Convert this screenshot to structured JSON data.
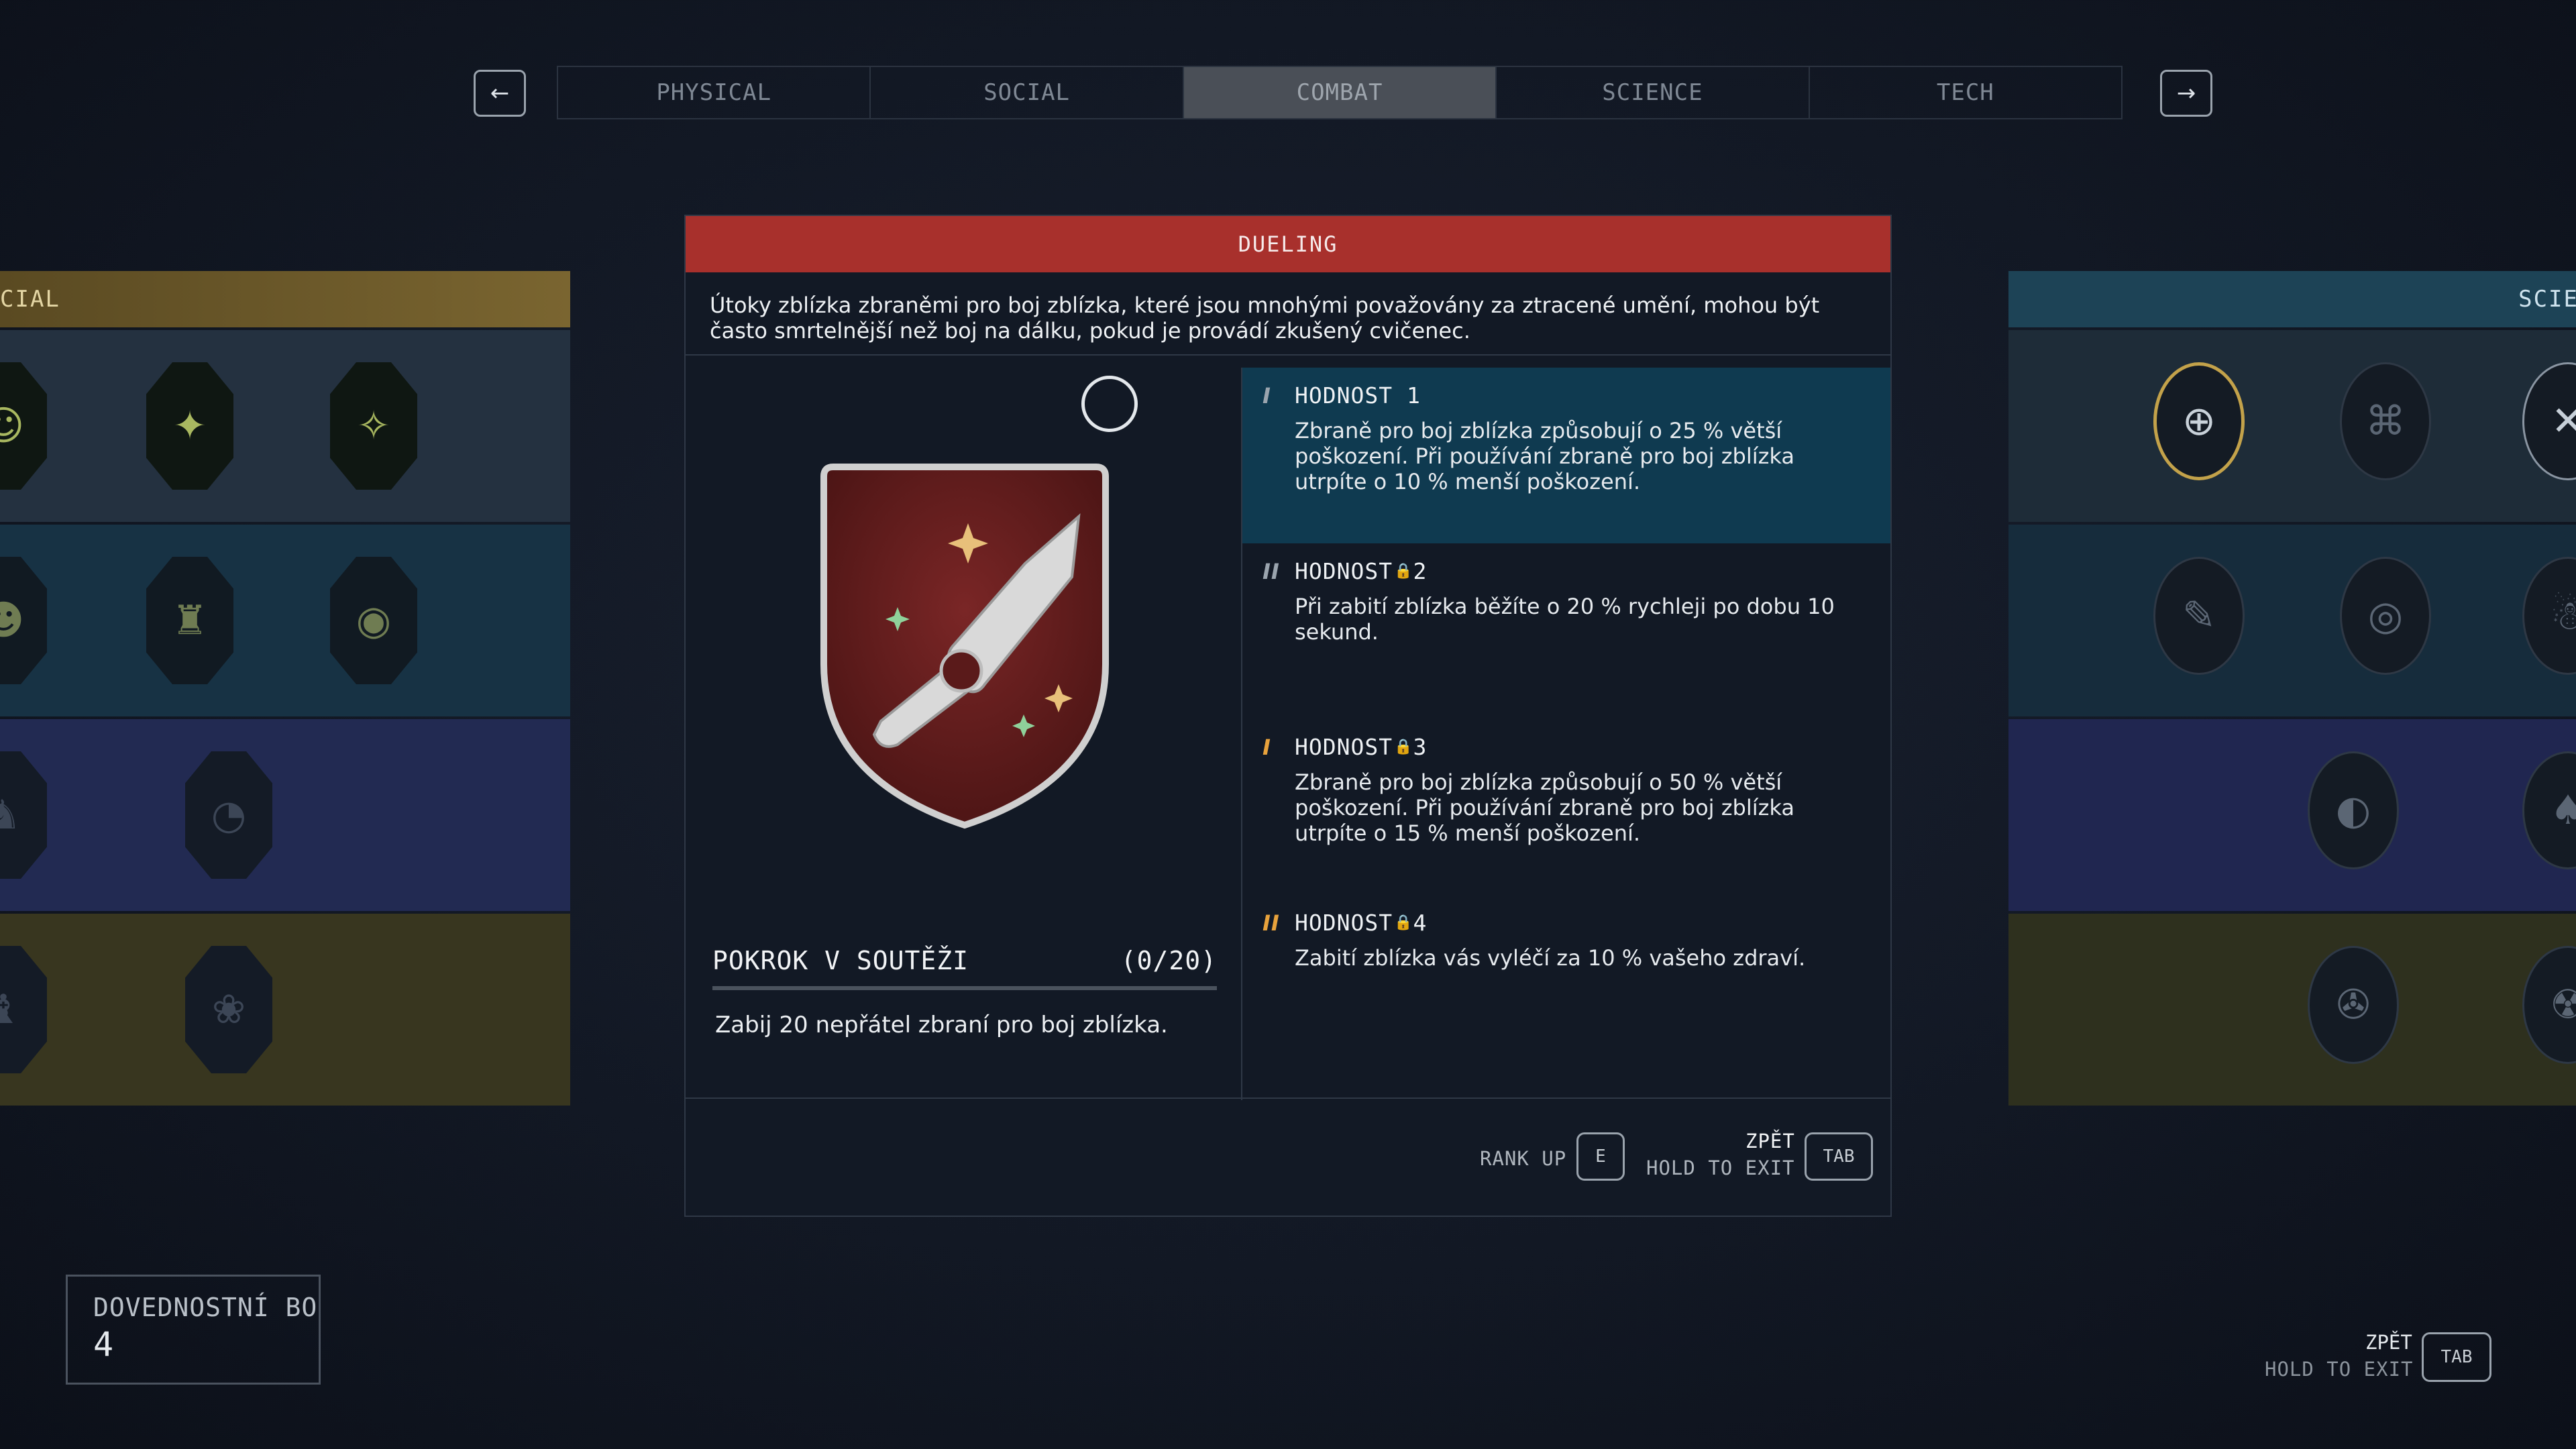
{
  "nav": {
    "prev_glyph": "←",
    "next_glyph": "→",
    "tabs": [
      {
        "label": "PHYSICAL",
        "active": false
      },
      {
        "label": "SOCIAL",
        "active": false
      },
      {
        "label": "COMBAT",
        "active": true
      },
      {
        "label": "SCIENCE",
        "active": false
      },
      {
        "label": "TECH",
        "active": false
      }
    ]
  },
  "left_panel": {
    "header": "CIAL",
    "color": "#7a6530"
  },
  "right_panel": {
    "header": "SCIE",
    "color": "#1d4356"
  },
  "skill": {
    "title": "DUELING",
    "title_color": "#a8302c",
    "description": "Útoky zblízka zbraněmi pro boj zblízka, které jsou mnohými považovány za ztracené umění, mohou být často smrtelnější než boj na dálku, pokud je provádí zkušený cvičenec.",
    "progress": {
      "label": "POKROK V SOUTĚŽI",
      "count": "(0/20)",
      "fraction": 0.0,
      "description": "Zabij 20 nepřátel zbraní pro boj zblízka."
    },
    "ranks": [
      {
        "label": "HODNOST 1",
        "mark": "I",
        "text": "Zbraně pro boj zblízka způsobují o 25 % větší poškození. Při používání zbraně pro boj zblízka utrpíte o 10 % menší poškození.",
        "active": true
      },
      {
        "label": "HODNOST",
        "lock_suffix": "2",
        "mark": "II",
        "text": "Při zabití zblízka běžíte o 20 % rychleji po dobu 10 sekund.",
        "active": false
      },
      {
        "label": "HODNOST",
        "lock_suffix": "3",
        "mark": "I",
        "text": "Zbraně pro boj zblízka způsobují o 50 % větší poškození. Při používání zbraně pro boj zblízka utrpíte o 15 % menší poškození.",
        "active": false
      },
      {
        "label": "HODNOST",
        "lock_suffix": "4",
        "mark": "II",
        "text": "Zabití zblízka vás vyléčí za 10 % vašeho zdraví.",
        "active": false
      }
    ],
    "footer": {
      "rank_up_label": "RANK UP",
      "rank_up_key": "E",
      "back_label": "ZPĚT",
      "hold_label": "HOLD TO EXIT",
      "back_key": "TAB"
    }
  },
  "skill_points": {
    "label": "DOVEDNOSTNÍ BODY",
    "value": "4"
  },
  "global_hint": {
    "back_label": "ZPĚT",
    "hold_label": "HOLD TO EXIT",
    "key": "TAB"
  }
}
